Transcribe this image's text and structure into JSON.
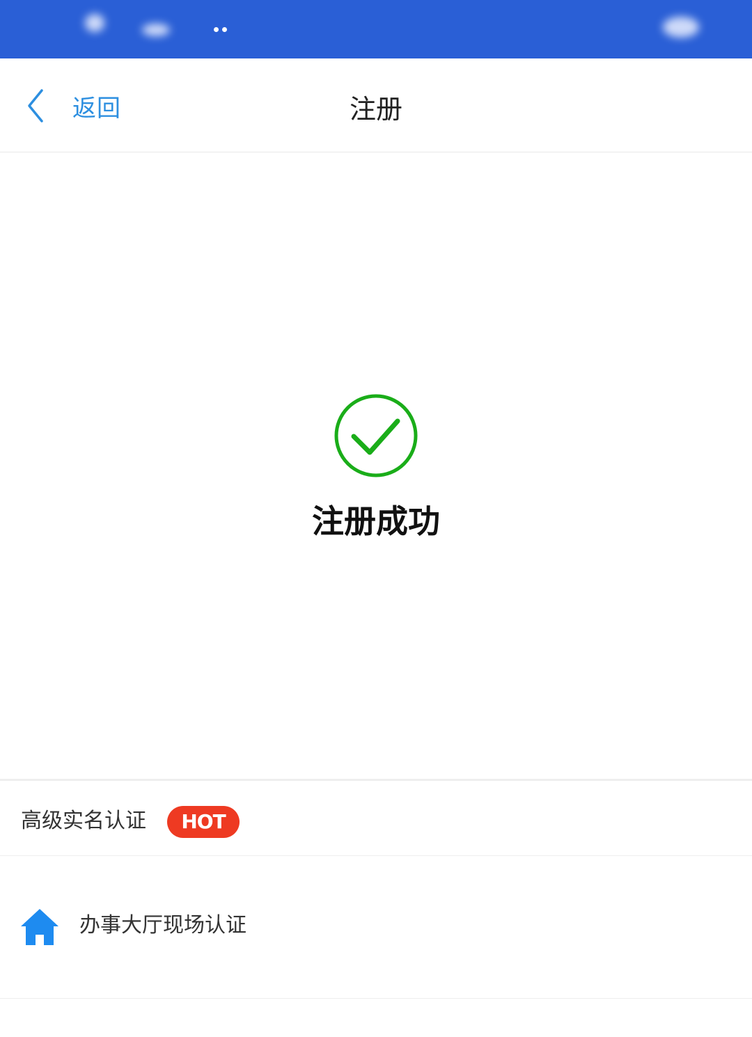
{
  "nav": {
    "back_label": "返回",
    "title": "注册"
  },
  "result": {
    "message": "注册成功",
    "status_color": "#1aad19"
  },
  "options": {
    "auth": {
      "label": "高级实名认证",
      "badge": "HOT",
      "badge_color": "#ee3a22"
    },
    "hall": {
      "icon": "home-icon",
      "label": "办事大厅现场认证",
      "icon_color": "#1e8bf0"
    }
  },
  "theme": {
    "status_bar_color": "#2a5fd6",
    "link_color": "#2d8fe0"
  }
}
